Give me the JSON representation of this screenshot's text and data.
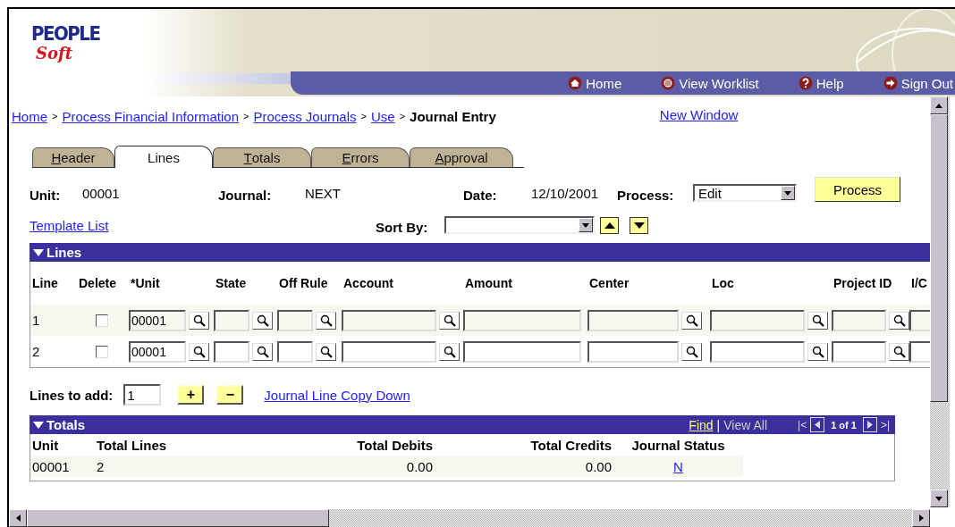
{
  "logo": {
    "line1": "PEOPLE",
    "line2": "Soft"
  },
  "nav": [
    {
      "label": "Home"
    },
    {
      "label": "View Worklist"
    },
    {
      "label": "Help"
    },
    {
      "label": "Sign Out"
    }
  ],
  "breadcrumb": [
    {
      "kind": "link",
      "text": "Home"
    },
    {
      "kind": "separator",
      "text": ">"
    },
    {
      "kind": "link",
      "text": "Process Financial Information"
    },
    {
      "kind": "separator",
      "text": ">"
    },
    {
      "kind": "link",
      "text": "Process Journals"
    },
    {
      "kind": "separator",
      "text": ">"
    },
    {
      "kind": "link",
      "text": "Use"
    },
    {
      "kind": "separator",
      "text": ">"
    },
    {
      "kind": "current",
      "text": "Journal Entry"
    }
  ],
  "new_window": "New Window",
  "tabs": [
    {
      "label": "Header",
      "underlined_first_letter": true,
      "selected": false
    },
    {
      "label": "Lines",
      "underlined_first_letter": false,
      "selected": true
    },
    {
      "label": "Totals",
      "underlined_first_letter": true,
      "selected": false
    },
    {
      "label": "Errors",
      "underlined_first_letter": true,
      "selected": false
    },
    {
      "label": "Approval",
      "underlined_first_letter": true,
      "selected": false
    }
  ],
  "header_fields": [
    {
      "label": "Unit:",
      "value": "00001"
    },
    {
      "label": "Journal:",
      "value": "NEXT"
    },
    {
      "label": "Date:",
      "value": "12/10/2001"
    }
  ],
  "process": {
    "label": "Process:",
    "value": "Edit",
    "button": "Process"
  },
  "template_link": "Template List",
  "sort_by": {
    "label": "Sort By:"
  },
  "lines_section": {
    "title": "Lines",
    "expanded": true,
    "columns": [
      "Line",
      "Delete",
      "*Unit",
      "State",
      "Off Rule",
      "Account",
      "Amount",
      "Center",
      "Loc",
      "Project ID",
      "I/C"
    ],
    "rows": [
      {
        "line": "1",
        "delete": false,
        "unit": "00001"
      },
      {
        "line": "2",
        "delete": false,
        "unit": "00001"
      }
    ]
  },
  "lines_to_add": {
    "label": "Lines to add:",
    "value": "1",
    "add": "+",
    "remove": "−"
  },
  "copy_down_link": "Journal Line Copy Down",
  "totals_section": {
    "title": "Totals",
    "expanded": true,
    "find": "Find",
    "divider": "|",
    "view_all": "View All",
    "first": "|<",
    "range": "1 of 1",
    "last": ">|",
    "columns": [
      "Unit",
      "Total Lines",
      "Total Debits",
      "Total Credits",
      "Journal Status"
    ],
    "rows": [
      {
        "unit": "00001",
        "total_lines": "2",
        "total_debits": "0.00",
        "total_credits": "0.00",
        "journal_status": "N"
      }
    ]
  }
}
